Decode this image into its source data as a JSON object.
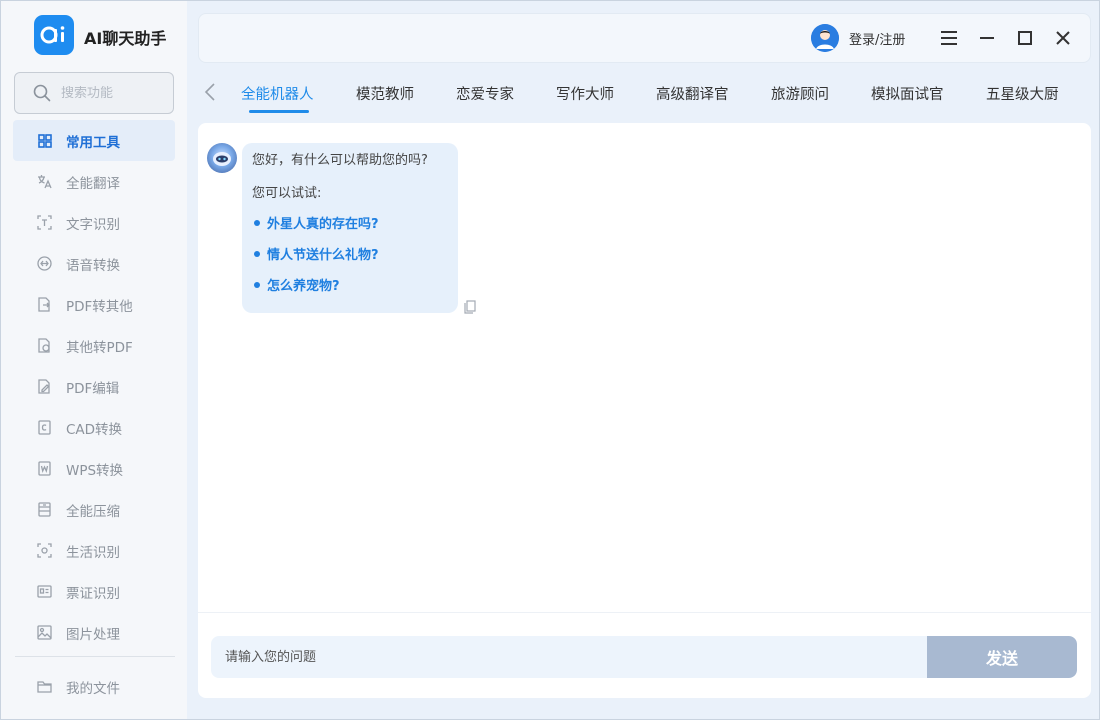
{
  "app": {
    "title": "AI聊天助手",
    "logo_text": "ai",
    "accent_color": "#1f8be9"
  },
  "search": {
    "placeholder": "搜索功能"
  },
  "sidebar": {
    "items": [
      {
        "label": "常用工具",
        "icon": "grid-icon",
        "active": true
      },
      {
        "label": "全能翻译",
        "icon": "translate-icon"
      },
      {
        "label": "文字识别",
        "icon": "text-scan-icon"
      },
      {
        "label": "语音转换",
        "icon": "audio-convert-icon"
      },
      {
        "label": "PDF转其他",
        "icon": "pdf-convert-icon"
      },
      {
        "label": "其他转PDF",
        "icon": "to-pdf-icon"
      },
      {
        "label": "PDF编辑",
        "icon": "pdf-edit-icon"
      },
      {
        "label": "CAD转换",
        "icon": "cad-icon"
      },
      {
        "label": "WPS转换",
        "icon": "wps-icon"
      },
      {
        "label": "全能压缩",
        "icon": "compress-icon"
      },
      {
        "label": "生活识别",
        "icon": "camera-scan-icon"
      },
      {
        "label": "票证识别",
        "icon": "id-card-icon"
      },
      {
        "label": "图片处理",
        "icon": "image-icon"
      }
    ],
    "bottom": {
      "label": "我的文件",
      "icon": "folder-icon"
    }
  },
  "header": {
    "login_label": "登录/注册",
    "buttons": [
      "menu-icon",
      "minimize-icon",
      "maximize-icon",
      "close-icon"
    ]
  },
  "tabs": [
    {
      "label": "全能机器人",
      "active": true
    },
    {
      "label": "模范教师"
    },
    {
      "label": "恋爱专家"
    },
    {
      "label": "写作大师"
    },
    {
      "label": "高级翻译官"
    },
    {
      "label": "旅游顾问"
    },
    {
      "label": "模拟面试官"
    },
    {
      "label": "五星级大厨"
    }
  ],
  "chat": {
    "greeting": "您好，有什么可以帮助您的吗?",
    "try_label": "您可以试试:",
    "suggestions": [
      "外星人真的存在吗?",
      "情人节送什么礼物?",
      "怎么养宠物?"
    ]
  },
  "composer": {
    "placeholder": "请输入您的问题",
    "send_label": "发送"
  }
}
